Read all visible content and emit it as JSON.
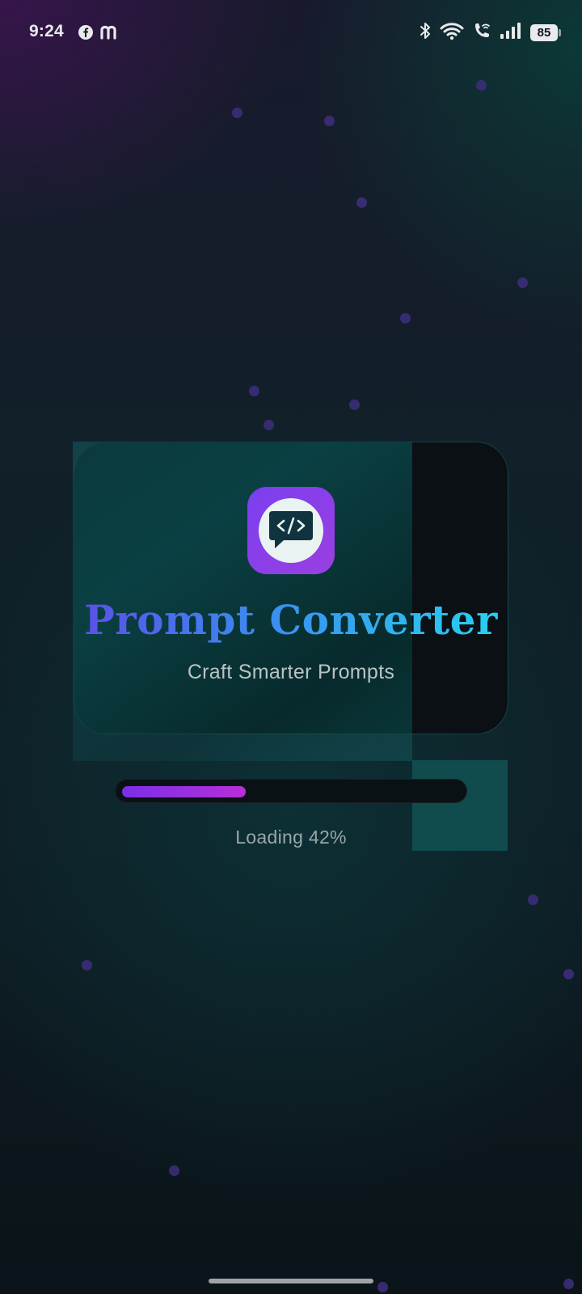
{
  "status_bar": {
    "time": "9:24",
    "notification_icons": [
      "facebook-icon",
      "m-app-icon"
    ],
    "system_icons": [
      "bluetooth-icon",
      "wifi-icon",
      "wifi-calling-icon",
      "signal-icon"
    ],
    "battery": "85"
  },
  "splash": {
    "title": "Prompt Converter",
    "tagline": "Craft Smarter Prompts",
    "logo_icon": "code-chat-bubble-icon",
    "title_gradient": [
      "#5b4ee6",
      "#27d3f0"
    ]
  },
  "loading": {
    "label": "Loading 42%",
    "progress": 0.42,
    "fill_colors": [
      "#7b2fe8",
      "#b72fd8"
    ]
  },
  "colors": {
    "particle": "#3c2d7a",
    "logo_bg": "#8a3fe8",
    "card_bg": "#0a4043"
  }
}
